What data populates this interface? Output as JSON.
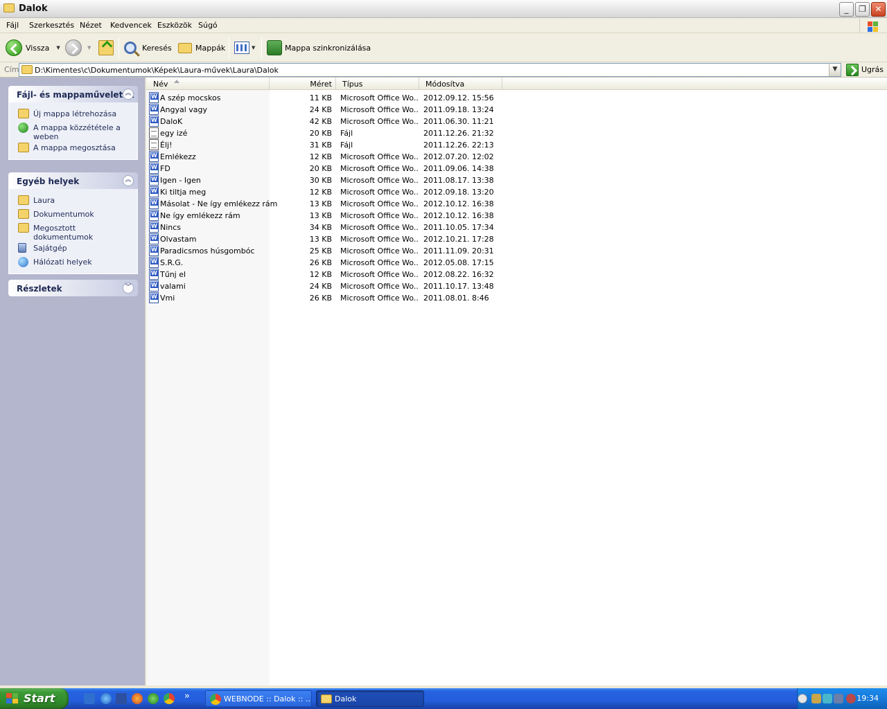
{
  "window": {
    "title": "Dalok"
  },
  "menu": [
    "Fájl",
    "Szerkesztés",
    "Nézet",
    "Kedvencek",
    "Eszközök",
    "Súgó"
  ],
  "toolbar": {
    "back": "Vissza",
    "search": "Keresés",
    "folders": "Mappák",
    "sync": "Mappa szinkronizálása"
  },
  "address": {
    "label": "Cím",
    "path": "D:\\Kimentes\\c\\Dokumentumok\\Képek\\Laura-művek\\Laura\\Dalok",
    "go": "Ugrás"
  },
  "tasks": {
    "title": "Fájl- és mappaműveletek",
    "items": [
      "Új mappa létrehozása",
      "A mappa közzététele a weben",
      "A mappa megosztása"
    ]
  },
  "places": {
    "title": "Egyéb helyek",
    "items": [
      "Laura",
      "Dokumentumok",
      "Megosztott dokumentumok",
      "Sajátgép",
      "Hálózati helyek"
    ]
  },
  "details": {
    "title": "Részletek"
  },
  "columns": {
    "name": "Név",
    "size": "Méret",
    "type": "Típus",
    "modified": "Módosítva"
  },
  "files": [
    {
      "name": "A szép mocskos",
      "size": "11 KB",
      "type": "Microsoft Office Wo...",
      "modified": "2012.09.12. 15:56",
      "icon": "word"
    },
    {
      "name": "Angyal vagy",
      "size": "24 KB",
      "type": "Microsoft Office Wo...",
      "modified": "2011.09.18. 13:24",
      "icon": "word"
    },
    {
      "name": "DaloK",
      "size": "42 KB",
      "type": "Microsoft Office Wo...",
      "modified": "2011.06.30. 11:21",
      "icon": "word"
    },
    {
      "name": "egy izé",
      "size": "20 KB",
      "type": "Fájl",
      "modified": "2011.12.26. 21:32",
      "icon": "file"
    },
    {
      "name": "Élj!",
      "size": "31 KB",
      "type": "Fájl",
      "modified": "2011.12.26. 22:13",
      "icon": "file"
    },
    {
      "name": "Emlékezz",
      "size": "12 KB",
      "type": "Microsoft Office Wo...",
      "modified": "2012.07.20. 12:02",
      "icon": "word"
    },
    {
      "name": "FD",
      "size": "20 KB",
      "type": "Microsoft Office Wo...",
      "modified": "2011.09.06. 14:38",
      "icon": "word"
    },
    {
      "name": "Igen - Igen",
      "size": "30 KB",
      "type": "Microsoft Office Wo...",
      "modified": "2011.08.17. 13:38",
      "icon": "word"
    },
    {
      "name": "Ki tiltja meg",
      "size": "12 KB",
      "type": "Microsoft Office Wo...",
      "modified": "2012.09.18. 13:20",
      "icon": "word"
    },
    {
      "name": "Másolat - Ne így emlékezz rám",
      "size": "13 KB",
      "type": "Microsoft Office Wo...",
      "modified": "2012.10.12. 16:38",
      "icon": "word"
    },
    {
      "name": "Ne így emlékezz rám",
      "size": "13 KB",
      "type": "Microsoft Office Wo...",
      "modified": "2012.10.12. 16:38",
      "icon": "word"
    },
    {
      "name": "Nincs",
      "size": "34 KB",
      "type": "Microsoft Office Wo...",
      "modified": "2011.10.05. 17:34",
      "icon": "word"
    },
    {
      "name": "Olvastam",
      "size": "13 KB",
      "type": "Microsoft Office Wo...",
      "modified": "2012.10.21. 17:28",
      "icon": "word"
    },
    {
      "name": "Paradicsmos húsgombóc",
      "size": "25 KB",
      "type": "Microsoft Office Wo...",
      "modified": "2011.11.09. 20:31",
      "icon": "word"
    },
    {
      "name": "S.R.G.",
      "size": "26 KB",
      "type": "Microsoft Office Wo...",
      "modified": "2012.05.08. 17:15",
      "icon": "word"
    },
    {
      "name": "Tűnj el",
      "size": "12 KB",
      "type": "Microsoft Office Wo...",
      "modified": "2012.08.22. 16:32",
      "icon": "word"
    },
    {
      "name": "valami",
      "size": "24 KB",
      "type": "Microsoft Office Wo...",
      "modified": "2011.10.17. 13:48",
      "icon": "word"
    },
    {
      "name": "Vmi",
      "size": "26 KB",
      "type": "Microsoft Office Wo...",
      "modified": "2011.08.01. 8:46",
      "icon": "word"
    }
  ],
  "taskbar": {
    "start": "Start",
    "buttons": [
      "WEBNODE :: Dalok :: ...",
      "Dalok"
    ],
    "quicklaunch_more": "»",
    "clock": "19:34"
  }
}
